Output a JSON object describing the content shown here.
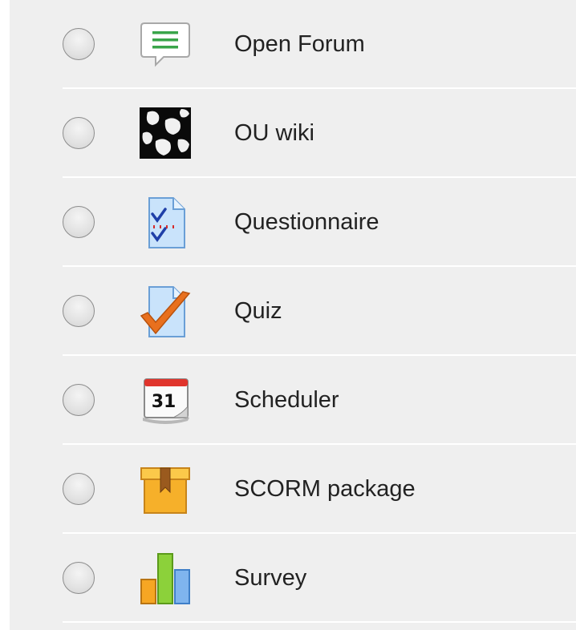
{
  "activities": [
    {
      "label": "Open Forum",
      "icon": "forum-icon"
    },
    {
      "label": "OU wiki",
      "icon": "wiki-icon"
    },
    {
      "label": "Questionnaire",
      "icon": "questionnaire-icon"
    },
    {
      "label": "Quiz",
      "icon": "quiz-icon"
    },
    {
      "label": "Scheduler",
      "icon": "calendar-icon",
      "icon_text": "31"
    },
    {
      "label": "SCORM package",
      "icon": "package-icon"
    },
    {
      "label": "Survey",
      "icon": "bar-chart-icon"
    }
  ],
  "colors": {
    "panel_background": "#efefef",
    "divider": "#ffffff",
    "text": "#222222"
  }
}
